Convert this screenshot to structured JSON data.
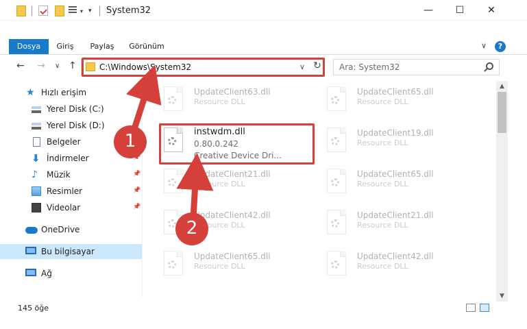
{
  "window": {
    "title": "System32",
    "minimize": "—",
    "maximize": "☐",
    "close": "✕"
  },
  "quick_access": {
    "caret": "▾",
    "caret2": "▾"
  },
  "ribbon": {
    "tabs": [
      "Dosya",
      "Giriş",
      "Paylaş",
      "Görünüm"
    ],
    "help": "?",
    "collapse": "∨"
  },
  "nav": {
    "back": "←",
    "forward": "→",
    "recent": "∨",
    "up": "↑",
    "address": "C:\\Windows\\System32",
    "address_caret": "∨",
    "refresh": "↻",
    "search_placeholder": "Ara: System32"
  },
  "sidebar": {
    "items": [
      {
        "label": "Hızlı erişim",
        "icon": "star-icon"
      },
      {
        "label": "Yerel Disk (C:)",
        "icon": "disk-icon"
      },
      {
        "label": "Yerel Disk (D:)",
        "icon": "disk-icon"
      },
      {
        "label": "Belgeler",
        "icon": "documents-icon"
      },
      {
        "label": "İndirmeler",
        "icon": "downloads-icon",
        "pin": "📌"
      },
      {
        "label": "Müzik",
        "icon": "music-icon",
        "pin": "📌"
      },
      {
        "label": "Resimler",
        "icon": "pictures-icon",
        "pin": "📌"
      },
      {
        "label": "Videolar",
        "icon": "videos-icon",
        "pin": "📌"
      },
      {
        "label": "OneDrive",
        "icon": "onedrive-icon"
      },
      {
        "label": "Bu bilgisayar",
        "icon": "computer-icon",
        "selected": true
      },
      {
        "label": "Ağ",
        "icon": "network-icon"
      }
    ]
  },
  "files": {
    "left": [
      {
        "name": "UpdateClient63.dll",
        "desc": "Resource DLL"
      },
      {
        "name": "UpdateClient21.dll",
        "desc": "Resource DLL"
      },
      {
        "name": "UpdateClient42.dll",
        "desc": "Resource DLL"
      },
      {
        "name": "UpdateClient65.dll",
        "desc": "Resource DLL"
      }
    ],
    "focus": {
      "name": "instwdm.dll",
      "version": "0.80.0.242",
      "desc": "Creative Device Dri..."
    },
    "right": [
      {
        "name": "UpdateClient65.dll",
        "desc": "Resource DLL"
      },
      {
        "name": "UpdateClient19.dll",
        "desc": "Resource DLL"
      },
      {
        "name": "UpdateClient65.dll",
        "desc": "Resource DLL"
      },
      {
        "name": "UpdateClient21.dll",
        "desc": "Resource DLL"
      },
      {
        "name": "UpdateClient42.dll",
        "desc": "Resource DLL"
      }
    ]
  },
  "scrollbar": {
    "up": "▲",
    "down": "▼"
  },
  "status": {
    "count": "145 öğe"
  },
  "callouts": [
    "1",
    "2"
  ],
  "colors": {
    "accent": "#1979ca",
    "highlight": "#d6403a",
    "selection": "#cce8ff"
  }
}
